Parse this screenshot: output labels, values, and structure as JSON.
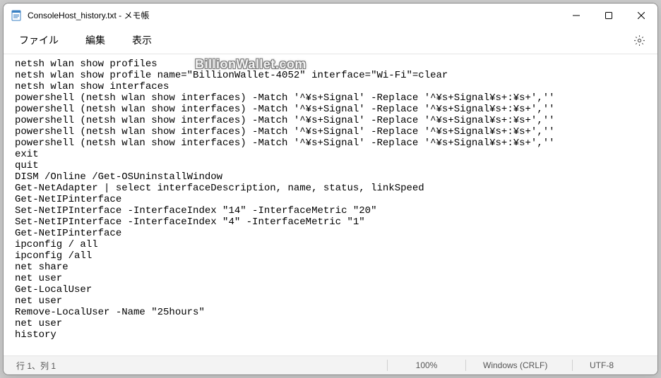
{
  "window": {
    "title": "ConsoleHost_history.txt - メモ帳"
  },
  "menu": {
    "file": "ファイル",
    "edit": "編集",
    "view": "表示"
  },
  "editor": {
    "content": "netsh wlan show profiles\nnetsh wlan show profile name=\"BillionWallet-4052\" interface=\"Wi-Fi\"=clear\nnetsh wlan show interfaces\npowershell (netsh wlan show interfaces) -Match '^¥s+Signal' -Replace '^¥s+Signal¥s+:¥s+',''\npowershell (netsh wlan show interfaces) -Match '^¥s+Signal' -Replace '^¥s+Signal¥s+:¥s+',''\npowershell (netsh wlan show interfaces) -Match '^¥s+Signal' -Replace '^¥s+Signal¥s+:¥s+',''\npowershell (netsh wlan show interfaces) -Match '^¥s+Signal' -Replace '^¥s+Signal¥s+:¥s+',''\npowershell (netsh wlan show interfaces) -Match '^¥s+Signal' -Replace '^¥s+Signal¥s+:¥s+',''\nexit\nquit\nDISM /Online /Get-OSUninstallWindow\nGet-NetAdapter | select interfaceDescription, name, status, linkSpeed\nGet-NetIPinterface\nSet-NetIPInterface -InterfaceIndex \"14\" -InterfaceMetric \"20\"\nSet-NetIPInterface -InterfaceIndex \"4\" -InterfaceMetric \"1\"\nGet-NetIPinterface\nipconfig / all\nipconfig /all\nnet share\nnet user\nGet-LocalUser\nnet user\nRemove-LocalUser -Name \"25hours\"\nnet user\nhistory"
  },
  "watermark": "BillionWallet.com",
  "status": {
    "cursor": "行 1、列 1",
    "zoom": "100%",
    "eol": "Windows (CRLF)",
    "encoding": "UTF-8"
  }
}
